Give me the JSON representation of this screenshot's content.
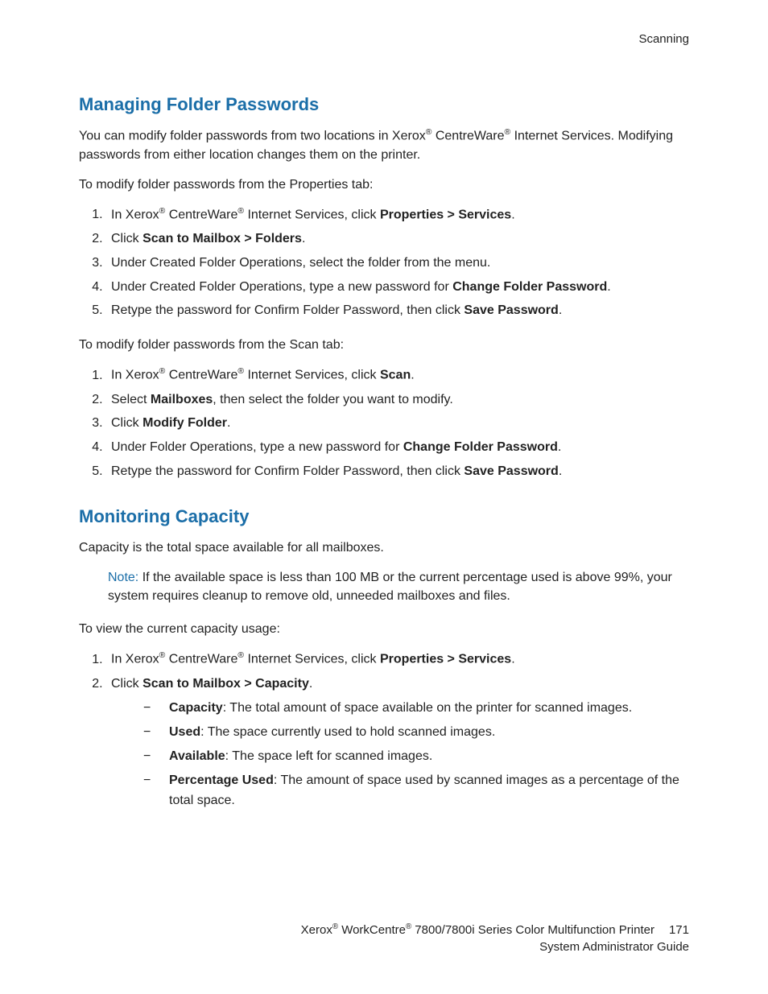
{
  "header": {
    "section": "Scanning"
  },
  "s1": {
    "title": "Managing Folder Passwords",
    "intro_a": "You can modify folder passwords from two locations in Xerox",
    "intro_b": " CentreWare",
    "intro_c": " Internet Services. Modifying passwords from either location changes them on the printer.",
    "lead1": "To modify folder passwords from the Properties tab:",
    "list1": {
      "i1a": "In Xerox",
      "i1b": " CentreWare",
      "i1c": " Internet Services, click ",
      "i1d": "Properties > Services",
      "i1e": ".",
      "i2a": "Click ",
      "i2b": "Scan to Mailbox > Folders",
      "i2c": ".",
      "i3": "Under Created Folder Operations, select the folder from the menu.",
      "i4a": "Under Created Folder Operations, type a new password for ",
      "i4b": "Change Folder Password",
      "i4c": ".",
      "i5a": "Retype the password for Confirm Folder Password, then click ",
      "i5b": "Save Password",
      "i5c": "."
    },
    "lead2": "To modify folder passwords from the Scan tab:",
    "list2": {
      "i1a": "In Xerox",
      "i1b": " CentreWare",
      "i1c": " Internet Services, click ",
      "i1d": "Scan",
      "i1e": ".",
      "i2a": "Select ",
      "i2b": "Mailboxes",
      "i2c": ", then select the folder you want to modify.",
      "i3a": "Click ",
      "i3b": "Modify Folder",
      "i3c": ".",
      "i4a": "Under Folder Operations, type a new password for ",
      "i4b": "Change Folder Password",
      "i4c": ".",
      "i5a": "Retype the password for Confirm Folder Password, then click ",
      "i5b": "Save Password",
      "i5c": "."
    }
  },
  "s2": {
    "title": "Monitoring Capacity",
    "intro": "Capacity is the total space available for all mailboxes.",
    "note_label": "Note:",
    "note_text": " If the available space is less than 100 MB or the current percentage used is above 99%, your system requires cleanup to remove old, unneeded mailboxes and files.",
    "lead": "To view the current capacity usage:",
    "list": {
      "i1a": "In Xerox",
      "i1b": " CentreWare",
      "i1c": " Internet Services, click ",
      "i1d": "Properties > Services",
      "i1e": ".",
      "i2a": "Click ",
      "i2b": "Scan to Mailbox > Capacity",
      "i2c": ".",
      "d1a": "Capacity",
      "d1b": ": The total amount of space available on the printer for scanned images.",
      "d2a": "Used",
      "d2b": ": The space currently used to hold scanned images.",
      "d3a": "Available",
      "d3b": ": The space left for scanned images.",
      "d4a": "Percentage Used",
      "d4b": ": The amount of space used by scanned images as a percentage of the total space."
    }
  },
  "footer": {
    "line1a": "Xerox",
    "line1b": " WorkCentre",
    "line1c": " 7800/7800i Series Color Multifunction Printer",
    "page": "171",
    "line2": "System Administrator Guide"
  },
  "glyph": {
    "reg": "®"
  }
}
